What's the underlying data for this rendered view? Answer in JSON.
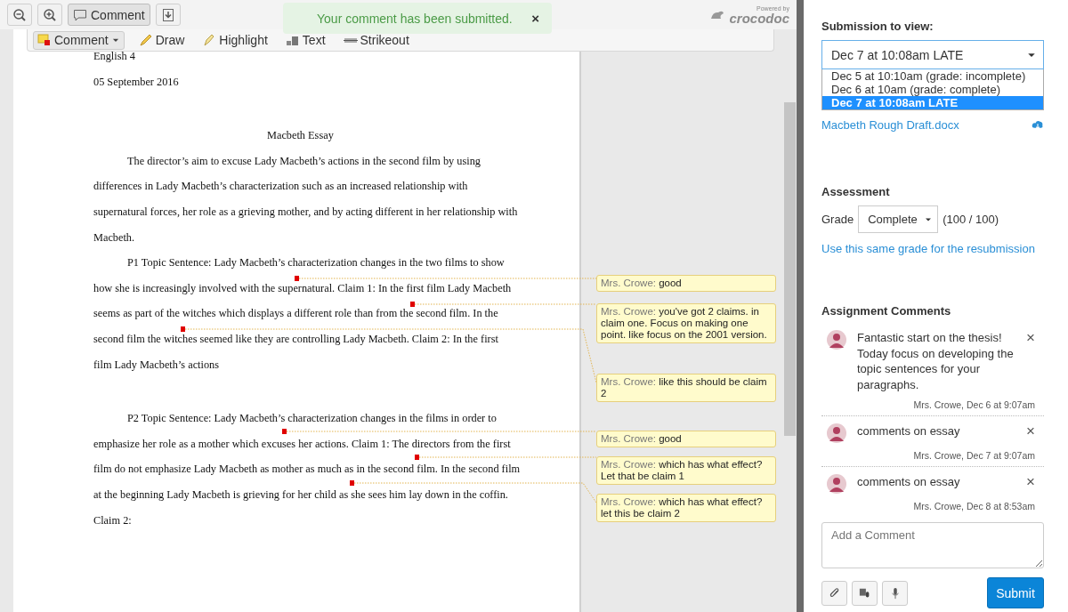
{
  "toolbar": {
    "comment_label": "Comment"
  },
  "toast": {
    "message": "Your comment has been submitted.",
    "close": "×"
  },
  "branding": {
    "powered_by": "Powered by",
    "name": "crocodoc"
  },
  "annotation_tools": [
    {
      "kind": "comment",
      "label": "Comment"
    },
    {
      "kind": "draw",
      "label": "Draw"
    },
    {
      "kind": "highlight",
      "label": "Highlight"
    },
    {
      "kind": "text",
      "label": "Text"
    },
    {
      "kind": "strikeout",
      "label": "Strikeout"
    }
  ],
  "document": {
    "blocks": [
      {
        "lines": [
          {
            "kind": "plain",
            "text": "English 4"
          },
          {
            "kind": "plain",
            "text": "05 September 2016"
          }
        ]
      },
      {
        "lines": [
          {
            "kind": "center",
            "text": "Macbeth Essay"
          },
          {
            "kind": "indent",
            "text": "The director’s aim to excuse Lady Macbeth’s actions in the second film by using"
          },
          {
            "kind": "plain",
            "text": "differences in Lady Macbeth’s characterization such as an increased relationship with"
          },
          {
            "kind": "plain",
            "text": "supernatural forces, her role as a grieving mother, and by acting different in her relationship with"
          },
          {
            "kind": "plain",
            "text": "Macbeth."
          },
          {
            "kind": "indent",
            "text": "P1 Topic Sentence: Lady Macbeth’s characterization changes in the two films to show"
          },
          {
            "kind": "plain",
            "text": "how she is increasingly involved with the supernatural. Claim 1: In the first film Lady Macbeth"
          },
          {
            "kind": "plain",
            "text": "seems as part of the witches which displays a different role than from the second film. In the"
          },
          {
            "kind": "plain",
            "text": "second film the witches seemed like they are controlling Lady Macbeth. Claim 2:  In the first"
          },
          {
            "kind": "plain",
            "text": "film Lady Macbeth’s actions"
          }
        ]
      },
      {
        "lines": [
          {
            "kind": "indent",
            "text": "P2 Topic Sentence:  Lady Macbeth’s characterization changes in the films in order to"
          },
          {
            "kind": "plain",
            "text": "emphasize her role as a mother which excuses her actions. Claim 1: The directors from the first"
          },
          {
            "kind": "plain",
            "text": "film do not emphasize Lady Macbeth as mother as much as in the second film. In the second film"
          },
          {
            "kind": "plain",
            "text": "at the beginning Lady Macbeth is grieving for her child as she sees him lay down in the coffin."
          },
          {
            "kind": "plain",
            "text": "Claim 2:"
          }
        ]
      }
    ]
  },
  "notes": [
    {
      "author": "Mrs. Crowe:",
      "text": "good"
    },
    {
      "author": "Mrs. Crowe:",
      "text": "you've got 2 claims. in claim one. Focus on making one point. like focus on the 2001 version."
    },
    {
      "author": "Mrs. Crowe:",
      "text": "like this should be claim 2"
    },
    {
      "author": "Mrs. Crowe:",
      "text": "good"
    },
    {
      "author": "Mrs. Crowe:",
      "text": "which has what effect? Let that be claim 1"
    },
    {
      "author": "Mrs. Crowe:",
      "text": "which has what effect? let this be claim 2"
    }
  ],
  "sidebar": {
    "submission_label": "Submission to view:",
    "submission_select": {
      "value": "Dec 7 at 10:08am LATE",
      "options": [
        {
          "label": "Dec 5 at 10:10am (grade: incomplete)",
          "selected": false
        },
        {
          "label": "Dec 6 at 10am (grade: complete)",
          "selected": false
        },
        {
          "label": "Dec 7 at 10:08am LATE",
          "selected": true
        }
      ]
    },
    "file_link": "Macbeth Rough Draft.docx",
    "assessment": {
      "heading": "Assessment",
      "grade_label": "Grade",
      "grade_value": "Complete",
      "score": "(100 / 100)",
      "link": "Use this same grade for the resubmission"
    },
    "comments": {
      "heading": "Assignment Comments",
      "items": [
        {
          "text": "Fantastic start on the thesis! Today focus on developing the topic sentences for your paragraphs.",
          "meta": "Mrs. Crowe, Dec 6 at 9:07am",
          "close": "×"
        },
        {
          "text": "comments on essay",
          "meta": "Mrs. Crowe, Dec 7 at 9:07am",
          "close": "×"
        },
        {
          "text": "comments on essay",
          "meta": "Mrs. Crowe, Dec 8 at 8:53am",
          "close": "×"
        }
      ]
    },
    "add_comment": {
      "placeholder": "Add a Comment"
    },
    "submit": "Submit"
  }
}
